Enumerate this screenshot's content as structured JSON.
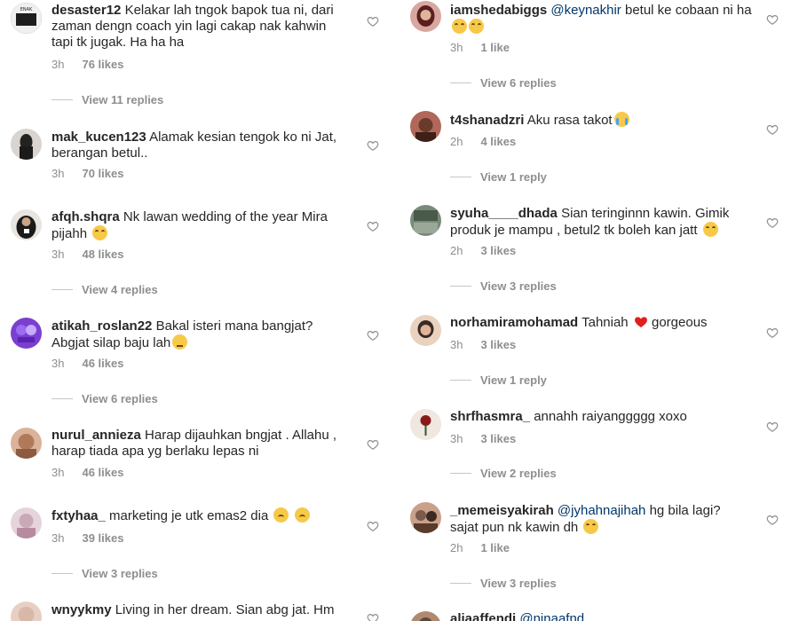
{
  "left": [
    {
      "user": "desaster12",
      "text": "Kelakar lah tngok bapok tua ni, dari zaman dengn coach yin lagi cakap nak kahwin tapi tk jugak. Ha ha ha",
      "time": "3h",
      "likes": "76 likes",
      "replies": "View 11 replies",
      "avatar_color": "#3a3a3a"
    },
    {
      "user": "mak_kucen123",
      "text": "Alamak kesian tengok ko ni Jat, berangan betul..",
      "time": "3h",
      "likes": "70 likes",
      "replies": "",
      "avatar_color": "#2b2b2b"
    },
    {
      "user": "afqh.shqra",
      "text": "Nk lawan wedding of the year Mira pijahh",
      "time": "3h",
      "likes": "48 likes",
      "replies": "View 4 replies",
      "avatar_color": "#1f1f1f",
      "emoji": "laugh"
    },
    {
      "user": "atikah_roslan22",
      "text": "Bakal isteri mana bangjat? Abgjat silap baju lah",
      "time": "3h",
      "likes": "46 likes",
      "replies": "View 6 replies",
      "avatar_color": "#7a3fd1",
      "emoji": "pensive"
    },
    {
      "user": "nurul_annieza",
      "text": "Harap dijauhkan bngjat . Allahu , harap tiada apa yg berlaku lepas ni",
      "time": "3h",
      "likes": "46 likes",
      "replies": "",
      "avatar_color": "#b07a5a"
    },
    {
      "user": "fxtyhaa_",
      "text": "marketing je utk emas2 dia",
      "time": "3h",
      "likes": "39 likes",
      "replies": "View 3 replies",
      "avatar_color": "#c9a9b5",
      "emoji": "sad2"
    },
    {
      "user": "wnyykmy",
      "text": "Living in her dream. Sian abg jat. Hm",
      "time": "",
      "likes": "",
      "replies": "",
      "avatar_color": "#d8b8a8"
    }
  ],
  "right": [
    {
      "user": "iamshedabiggs",
      "mention": "@keynakhir",
      "text": "betul ke cobaan ni ha",
      "time": "3h",
      "likes": "1 like",
      "replies": "View 6 replies",
      "avatar_color": "#a04a4a",
      "emoji": "laugh2"
    },
    {
      "user": "t4shanadzri",
      "text": "Aku rasa takot",
      "time": "2h",
      "likes": "4 likes",
      "replies": "View 1 reply",
      "avatar_color": "#6a3a2a",
      "emoji": "cry"
    },
    {
      "user": "syuha____dhada",
      "text": "Sian teringinnn kawin. Gimik produk je mampu , betul2 tk boleh kan jatt",
      "time": "2h",
      "likes": "3 likes",
      "replies": "View 3 replies",
      "avatar_color": "#4a5a4a",
      "emoji": "laugh"
    },
    {
      "user": "norhamiramohamad",
      "text": "Tahniah",
      "text2": "gorgeous",
      "time": "3h",
      "likes": "3 likes",
      "replies": "View 1 reply",
      "avatar_color": "#c8a080",
      "emoji": "heart"
    },
    {
      "user": "shrfhasmra_",
      "text": "annahh raiyanggggg xoxo",
      "time": "3h",
      "likes": "3 likes",
      "replies": "View 2 replies",
      "avatar_color": "#8a2a2a"
    },
    {
      "user": "_memeisyakirah",
      "mention": "@jyhahnajihah",
      "text": "hg bila lagi? sajat pun nk kawin dh",
      "time": "2h",
      "likes": "1 like",
      "replies": "View 3 replies",
      "avatar_color": "#7a5a4a",
      "emoji": "laugh"
    },
    {
      "user": "aliaaffendi",
      "mention": "@ninaafnd",
      "text": "",
      "time": "",
      "likes": "",
      "replies": "",
      "avatar_color": "#5a4a3a"
    }
  ]
}
